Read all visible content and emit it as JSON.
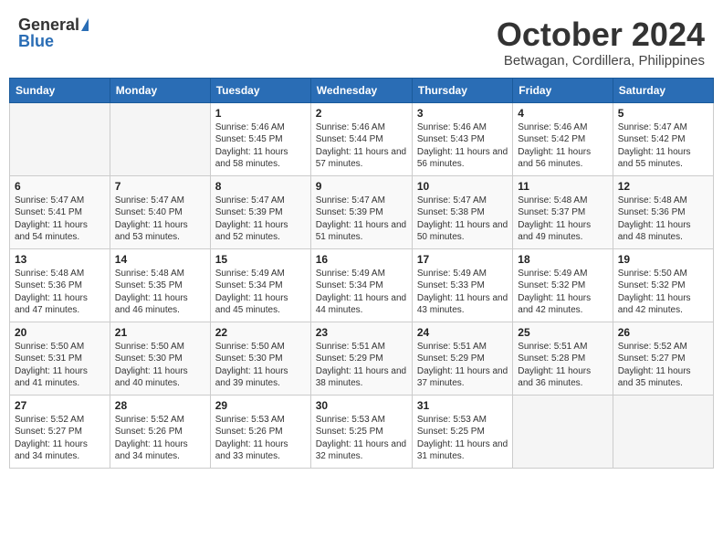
{
  "header": {
    "logo_general": "General",
    "logo_blue": "Blue",
    "title": "October 2024",
    "location": "Betwagan, Cordillera, Philippines"
  },
  "weekdays": [
    "Sunday",
    "Monday",
    "Tuesday",
    "Wednesday",
    "Thursday",
    "Friday",
    "Saturday"
  ],
  "weeks": [
    [
      {
        "day": "",
        "empty": true
      },
      {
        "day": "",
        "empty": true
      },
      {
        "day": "1",
        "sunrise": "Sunrise: 5:46 AM",
        "sunset": "Sunset: 5:45 PM",
        "daylight": "Daylight: 11 hours and 58 minutes."
      },
      {
        "day": "2",
        "sunrise": "Sunrise: 5:46 AM",
        "sunset": "Sunset: 5:44 PM",
        "daylight": "Daylight: 11 hours and 57 minutes."
      },
      {
        "day": "3",
        "sunrise": "Sunrise: 5:46 AM",
        "sunset": "Sunset: 5:43 PM",
        "daylight": "Daylight: 11 hours and 56 minutes."
      },
      {
        "day": "4",
        "sunrise": "Sunrise: 5:46 AM",
        "sunset": "Sunset: 5:42 PM",
        "daylight": "Daylight: 11 hours and 56 minutes."
      },
      {
        "day": "5",
        "sunrise": "Sunrise: 5:47 AM",
        "sunset": "Sunset: 5:42 PM",
        "daylight": "Daylight: 11 hours and 55 minutes."
      }
    ],
    [
      {
        "day": "6",
        "sunrise": "Sunrise: 5:47 AM",
        "sunset": "Sunset: 5:41 PM",
        "daylight": "Daylight: 11 hours and 54 minutes."
      },
      {
        "day": "7",
        "sunrise": "Sunrise: 5:47 AM",
        "sunset": "Sunset: 5:40 PM",
        "daylight": "Daylight: 11 hours and 53 minutes."
      },
      {
        "day": "8",
        "sunrise": "Sunrise: 5:47 AM",
        "sunset": "Sunset: 5:39 PM",
        "daylight": "Daylight: 11 hours and 52 minutes."
      },
      {
        "day": "9",
        "sunrise": "Sunrise: 5:47 AM",
        "sunset": "Sunset: 5:39 PM",
        "daylight": "Daylight: 11 hours and 51 minutes."
      },
      {
        "day": "10",
        "sunrise": "Sunrise: 5:47 AM",
        "sunset": "Sunset: 5:38 PM",
        "daylight": "Daylight: 11 hours and 50 minutes."
      },
      {
        "day": "11",
        "sunrise": "Sunrise: 5:48 AM",
        "sunset": "Sunset: 5:37 PM",
        "daylight": "Daylight: 11 hours and 49 minutes."
      },
      {
        "day": "12",
        "sunrise": "Sunrise: 5:48 AM",
        "sunset": "Sunset: 5:36 PM",
        "daylight": "Daylight: 11 hours and 48 minutes."
      }
    ],
    [
      {
        "day": "13",
        "sunrise": "Sunrise: 5:48 AM",
        "sunset": "Sunset: 5:36 PM",
        "daylight": "Daylight: 11 hours and 47 minutes."
      },
      {
        "day": "14",
        "sunrise": "Sunrise: 5:48 AM",
        "sunset": "Sunset: 5:35 PM",
        "daylight": "Daylight: 11 hours and 46 minutes."
      },
      {
        "day": "15",
        "sunrise": "Sunrise: 5:49 AM",
        "sunset": "Sunset: 5:34 PM",
        "daylight": "Daylight: 11 hours and 45 minutes."
      },
      {
        "day": "16",
        "sunrise": "Sunrise: 5:49 AM",
        "sunset": "Sunset: 5:34 PM",
        "daylight": "Daylight: 11 hours and 44 minutes."
      },
      {
        "day": "17",
        "sunrise": "Sunrise: 5:49 AM",
        "sunset": "Sunset: 5:33 PM",
        "daylight": "Daylight: 11 hours and 43 minutes."
      },
      {
        "day": "18",
        "sunrise": "Sunrise: 5:49 AM",
        "sunset": "Sunset: 5:32 PM",
        "daylight": "Daylight: 11 hours and 42 minutes."
      },
      {
        "day": "19",
        "sunrise": "Sunrise: 5:50 AM",
        "sunset": "Sunset: 5:32 PM",
        "daylight": "Daylight: 11 hours and 42 minutes."
      }
    ],
    [
      {
        "day": "20",
        "sunrise": "Sunrise: 5:50 AM",
        "sunset": "Sunset: 5:31 PM",
        "daylight": "Daylight: 11 hours and 41 minutes."
      },
      {
        "day": "21",
        "sunrise": "Sunrise: 5:50 AM",
        "sunset": "Sunset: 5:30 PM",
        "daylight": "Daylight: 11 hours and 40 minutes."
      },
      {
        "day": "22",
        "sunrise": "Sunrise: 5:50 AM",
        "sunset": "Sunset: 5:30 PM",
        "daylight": "Daylight: 11 hours and 39 minutes."
      },
      {
        "day": "23",
        "sunrise": "Sunrise: 5:51 AM",
        "sunset": "Sunset: 5:29 PM",
        "daylight": "Daylight: 11 hours and 38 minutes."
      },
      {
        "day": "24",
        "sunrise": "Sunrise: 5:51 AM",
        "sunset": "Sunset: 5:29 PM",
        "daylight": "Daylight: 11 hours and 37 minutes."
      },
      {
        "day": "25",
        "sunrise": "Sunrise: 5:51 AM",
        "sunset": "Sunset: 5:28 PM",
        "daylight": "Daylight: 11 hours and 36 minutes."
      },
      {
        "day": "26",
        "sunrise": "Sunrise: 5:52 AM",
        "sunset": "Sunset: 5:27 PM",
        "daylight": "Daylight: 11 hours and 35 minutes."
      }
    ],
    [
      {
        "day": "27",
        "sunrise": "Sunrise: 5:52 AM",
        "sunset": "Sunset: 5:27 PM",
        "daylight": "Daylight: 11 hours and 34 minutes."
      },
      {
        "day": "28",
        "sunrise": "Sunrise: 5:52 AM",
        "sunset": "Sunset: 5:26 PM",
        "daylight": "Daylight: 11 hours and 34 minutes."
      },
      {
        "day": "29",
        "sunrise": "Sunrise: 5:53 AM",
        "sunset": "Sunset: 5:26 PM",
        "daylight": "Daylight: 11 hours and 33 minutes."
      },
      {
        "day": "30",
        "sunrise": "Sunrise: 5:53 AM",
        "sunset": "Sunset: 5:25 PM",
        "daylight": "Daylight: 11 hours and 32 minutes."
      },
      {
        "day": "31",
        "sunrise": "Sunrise: 5:53 AM",
        "sunset": "Sunset: 5:25 PM",
        "daylight": "Daylight: 11 hours and 31 minutes."
      },
      {
        "day": "",
        "empty": true
      },
      {
        "day": "",
        "empty": true
      }
    ]
  ]
}
